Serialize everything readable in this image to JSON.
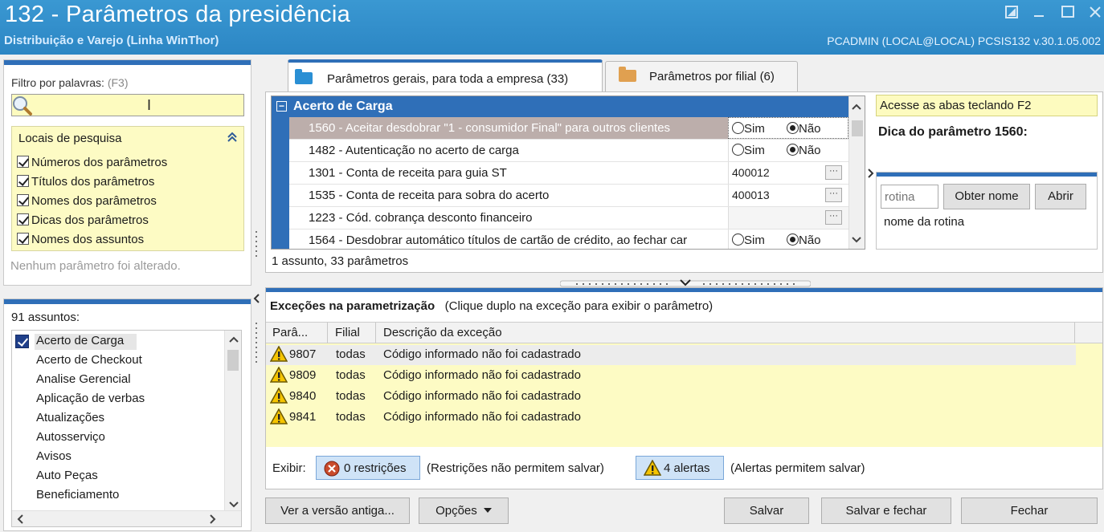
{
  "window": {
    "title": "132 - Parâmetros da presidência",
    "subtitle": "Distribuição e Varejo (Linha WinThor)",
    "user_info": "PCADMIN (LOCAL@LOCAL)  PCSIS132  v.30.1.05.002",
    "controls": [
      "restore",
      "minimize",
      "maximize",
      "close"
    ]
  },
  "filter": {
    "label": "Filtro por palavras:",
    "shortcut": "(F3)",
    "search_value": "",
    "locais_title": "Locais de pesquisa",
    "options": [
      {
        "label": "Números dos parâmetros",
        "checked": true
      },
      {
        "label": "Títulos dos parâmetros",
        "checked": true
      },
      {
        "label": "Nomes dos parâmetros",
        "checked": true
      },
      {
        "label": "Dicas dos parâmetros",
        "checked": true
      },
      {
        "label": "Nomes dos assuntos",
        "checked": true
      }
    ],
    "status": "Nenhum parâmetro foi alterado."
  },
  "subjects": {
    "count_label": "91 assuntos:",
    "items": [
      "Acerto de Carga",
      "Acerto de Checkout",
      "Analise Gerencial",
      "Aplicação de verbas",
      "Atualizações",
      "Autosserviço",
      "Avisos",
      "Auto Peças",
      "Beneficiamento"
    ],
    "selected_index": 0
  },
  "tabs": [
    {
      "label": "Parâmetros gerais, para toda a empresa",
      "count": "(33)",
      "active": true,
      "folder_color": "#2a8fd4"
    },
    {
      "label": "Parâmetros por filial",
      "count": "(6)",
      "active": false,
      "folder_color": "#e0a050"
    }
  ],
  "params": {
    "group_title": "Acerto de Carga",
    "rows": [
      {
        "text": "1560 - Aceitar desdobrar \"1 - consumidor Final\" para outros clientes",
        "kind": "radio",
        "value": "Não",
        "selected": true
      },
      {
        "text": "1482 - Autenticação no acerto de carga",
        "kind": "radio",
        "value": "Não"
      },
      {
        "text": "1301 - Conta de receita para guia ST",
        "kind": "lookup",
        "value": "400012"
      },
      {
        "text": "1535 - Conta de receita para sobra do acerto",
        "kind": "lookup",
        "value": "400013"
      },
      {
        "text": "1223 - Cód. cobrança desconto financeiro",
        "kind": "lookup",
        "value": ""
      },
      {
        "text": "1564 - Desdobrar automático títulos de cartão de crédito, ao fechar car",
        "kind": "radio",
        "value": "Não"
      }
    ],
    "radio_yes": "Sim",
    "radio_no": "Não",
    "lookup_button": "···",
    "summary": "1 assunto, 33 parâmetros"
  },
  "tips": {
    "access_tip": "Acesse as abas teclando F2",
    "tip_title": "Dica do parâmetro 1560:",
    "routine_placeholder": "rotina",
    "get_name_button": "Obter nome",
    "open_button": "Abrir",
    "routine_name": "nome da rotina"
  },
  "exceptions": {
    "title": "Exceções na parametrização",
    "hint": "(Clique duplo na exceção para exibir o parâmetro)",
    "columns": [
      "Parâ...",
      "Filial",
      "Descrição da exceção"
    ],
    "rows": [
      {
        "param": "9807",
        "branch": "todas",
        "description": "Código informado não foi cadastrado"
      },
      {
        "param": "9809",
        "branch": "todas",
        "description": "Código informado não foi cadastrado"
      },
      {
        "param": "9840",
        "branch": "todas",
        "description": "Código informado não foi cadastrado"
      },
      {
        "param": "9841",
        "branch": "todas",
        "description": "Código informado não foi cadastrado"
      }
    ],
    "show_label": "Exibir:",
    "restrictions_button": "0 restrições",
    "restrictions_note": "(Restrições não permitem salvar)",
    "alerts_button": "4 alertas",
    "alerts_note": "(Alertas permitem salvar)"
  },
  "footer": {
    "old_version_button": "Ver a versão antiga...",
    "options_button": "Opções",
    "save_button": "Salvar",
    "save_close_button": "Salvar e fechar",
    "close_button": "Fechar"
  },
  "colors": {
    "title_bar": "#2c86c4",
    "accent_blue": "#2f6fb8",
    "highlight_yellow": "#fdfbc4",
    "selected_row": "#bcaeab"
  }
}
